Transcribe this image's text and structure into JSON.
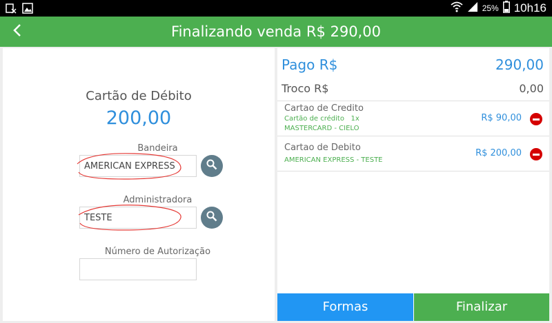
{
  "status_bar": {
    "icons": [
      "usb-debug-icon",
      "image-icon",
      "wifi-icon",
      "signal-icon",
      "battery-icon"
    ],
    "battery": "25%",
    "time": "10h16"
  },
  "header": {
    "title": "Finalizando venda R$ 290,00",
    "back_icon": "chevron-left-icon",
    "color": "#4caf50"
  },
  "payment_form": {
    "card_type": "Cartão de Débito",
    "amount": "200,00",
    "bandeira_label": "Bandeira",
    "bandeira_value": "AMERICAN EXPRESS",
    "administradora_label": "Administradora",
    "administradora_value": "TESTE",
    "autorizacao_label": "Número de Autorização",
    "autorizacao_value": "",
    "search_icon": "search-icon"
  },
  "summary": {
    "pago_label": "Pago R$",
    "pago_value": "290,00",
    "troco_label": "Troco R$",
    "troco_value": "0,00",
    "payments": [
      {
        "title": "Cartao de Credito",
        "sub1": "Cartão de crédito   1x",
        "sub2": "MASTERCARD - CIELO",
        "value": "R$ 90,00"
      },
      {
        "title": "Cartao de Debito",
        "sub1": "AMERICAN EXPRESS - TESTE",
        "value": "R$ 200,00"
      }
    ]
  },
  "buttons": {
    "formas": "Formas",
    "finalizar": "Finalizar"
  },
  "colors": {
    "accent_blue": "#2f8fdc",
    "green": "#4caf50",
    "button_blue": "#2196f3",
    "remove_red": "#d50000"
  }
}
